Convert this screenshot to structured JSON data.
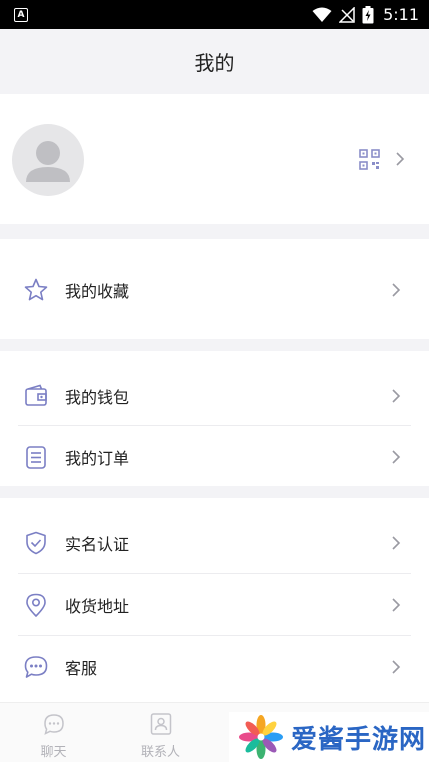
{
  "status_bar": {
    "time": "5:11",
    "app_badge": "A"
  },
  "header": {
    "title": "我的"
  },
  "menu_groups": [
    {
      "items": [
        {
          "label": "我的收藏",
          "icon": "star-icon"
        }
      ]
    },
    {
      "items": [
        {
          "label": "我的钱包",
          "icon": "wallet-icon"
        },
        {
          "label": "我的订单",
          "icon": "order-list-icon"
        }
      ]
    },
    {
      "items": [
        {
          "label": "实名认证",
          "icon": "shield-check-icon"
        },
        {
          "label": "收货地址",
          "icon": "location-pin-icon"
        },
        {
          "label": "客服",
          "icon": "chat-bubble-icon"
        }
      ]
    }
  ],
  "bottom_nav": [
    {
      "label": "聊天",
      "icon": "chat-icon"
    },
    {
      "label": "联系人",
      "icon": "contacts-icon"
    }
  ],
  "watermark": {
    "text": "爱酱手游网"
  },
  "colors": {
    "icon_accent": "#7b7fc4",
    "chevron": "#9a9aa2",
    "page_bg": "#f3f3f6"
  }
}
